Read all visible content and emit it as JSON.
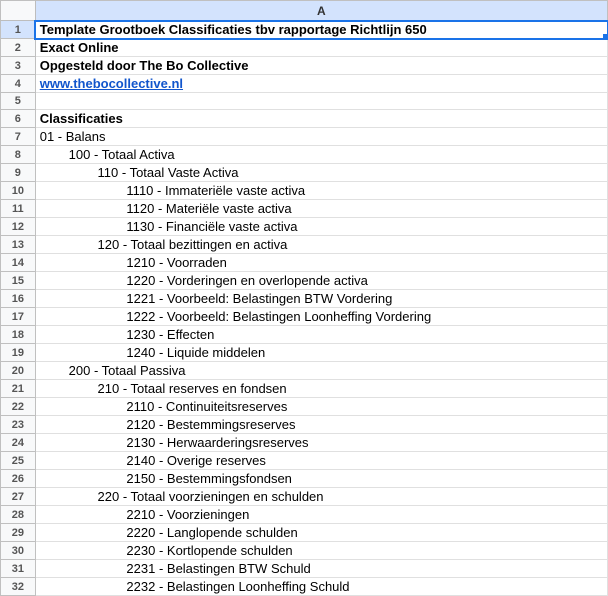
{
  "column_label": "A",
  "rows": [
    {
      "n": 1,
      "text": "Template Grootboek Classificaties tbv rapportage Richtlijn 650",
      "bold": true,
      "selected": true,
      "indent": 0
    },
    {
      "n": 2,
      "text": "Exact Online",
      "bold": true,
      "indent": 0
    },
    {
      "n": 3,
      "text": "Opgesteld door The Bo Collective",
      "bold": true,
      "indent": 0
    },
    {
      "n": 4,
      "text": "www.thebocollective.nl",
      "link": true,
      "indent": 0
    },
    {
      "n": 5,
      "text": "",
      "indent": 0
    },
    {
      "n": 6,
      "text": "Classificaties",
      "bold": true,
      "indent": 0
    },
    {
      "n": 7,
      "text": "01 - Balans",
      "indent": 0
    },
    {
      "n": 8,
      "text": "100 - Totaal Activa",
      "indent": 1
    },
    {
      "n": 9,
      "text": "110 - Totaal Vaste Activa",
      "indent": 2
    },
    {
      "n": 10,
      "text": "1110 - Immateriële vaste activa",
      "indent": 3
    },
    {
      "n": 11,
      "text": "1120 - Materiële vaste activa",
      "indent": 3
    },
    {
      "n": 12,
      "text": "1130 - Financiële vaste activa",
      "indent": 3
    },
    {
      "n": 13,
      "text": "120 - Totaal bezittingen en activa",
      "indent": 2
    },
    {
      "n": 14,
      "text": "1210 - Voorraden",
      "indent": 3
    },
    {
      "n": 15,
      "text": "1220 - Vorderingen en overlopende activa",
      "indent": 3
    },
    {
      "n": 16,
      "text": "1221 - Voorbeeld: Belastingen BTW Vordering",
      "indent": 3
    },
    {
      "n": 17,
      "text": "1222 - Voorbeeld: Belastingen Loonheffing Vordering",
      "indent": 3
    },
    {
      "n": 18,
      "text": "1230 - Effecten",
      "indent": 3
    },
    {
      "n": 19,
      "text": "1240 - Liquide middelen",
      "indent": 3
    },
    {
      "n": 20,
      "text": "200 - Totaal Passiva",
      "indent": 1
    },
    {
      "n": 21,
      "text": "210 - Totaal reserves en fondsen",
      "indent": 2
    },
    {
      "n": 22,
      "text": "2110 - Continuiteitsreserves",
      "indent": 3
    },
    {
      "n": 23,
      "text": "2120 - Bestemmingsreserves",
      "indent": 3
    },
    {
      "n": 24,
      "text": "2130 - Herwaarderingsreserves",
      "indent": 3
    },
    {
      "n": 25,
      "text": "2140 - Overige reserves",
      "indent": 3
    },
    {
      "n": 26,
      "text": "2150 - Bestemmingsfondsen",
      "indent": 3
    },
    {
      "n": 27,
      "text": "220 - Totaal voorzieningen en schulden",
      "indent": 2
    },
    {
      "n": 28,
      "text": "2210 - Voorzieningen",
      "indent": 3
    },
    {
      "n": 29,
      "text": "2220 - Langlopende schulden",
      "indent": 3
    },
    {
      "n": 30,
      "text": "2230 - Kortlopende schulden",
      "indent": 3
    },
    {
      "n": 31,
      "text": "2231 - Belastingen BTW Schuld",
      "indent": 3
    },
    {
      "n": 32,
      "text": "2232 - Belastingen Loonheffing Schuld",
      "indent": 3
    }
  ],
  "indent_unit": "        "
}
